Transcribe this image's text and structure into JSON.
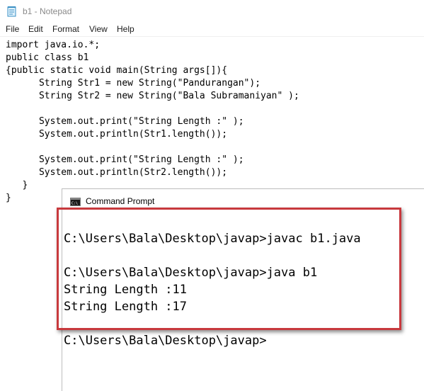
{
  "notepad": {
    "title": "b1 - Notepad",
    "menu": [
      "File",
      "Edit",
      "Format",
      "View",
      "Help"
    ],
    "code_lines": [
      "import java.io.*;",
      "public class b1",
      "{public static void main(String args[]){",
      "      String Str1 = new String(\"Pandurangan\");",
      "      String Str2 = new String(\"Bala Subramaniyan\" );",
      "",
      "      System.out.print(\"String Length :\" );",
      "      System.out.println(Str1.length());",
      "",
      "      System.out.print(\"String Length :\" );",
      "      System.out.println(Str2.length());",
      "   }",
      "}"
    ]
  },
  "cmd": {
    "title": "Command Prompt",
    "lines": [
      "C:\\Users\\Bala\\Desktop\\javap>javac b1.java",
      "",
      "C:\\Users\\Bala\\Desktop\\javap>java b1",
      "String Length :11",
      "String Length :17",
      "",
      "C:\\Users\\Bala\\Desktop\\javap>"
    ]
  },
  "colors": {
    "highlight_border": "#c8393d",
    "terminal_bg": "#ffffff",
    "terminal_text": "#000000"
  },
  "icons": {
    "notepad": "notepad-icon",
    "cmd": "command-prompt-icon"
  }
}
